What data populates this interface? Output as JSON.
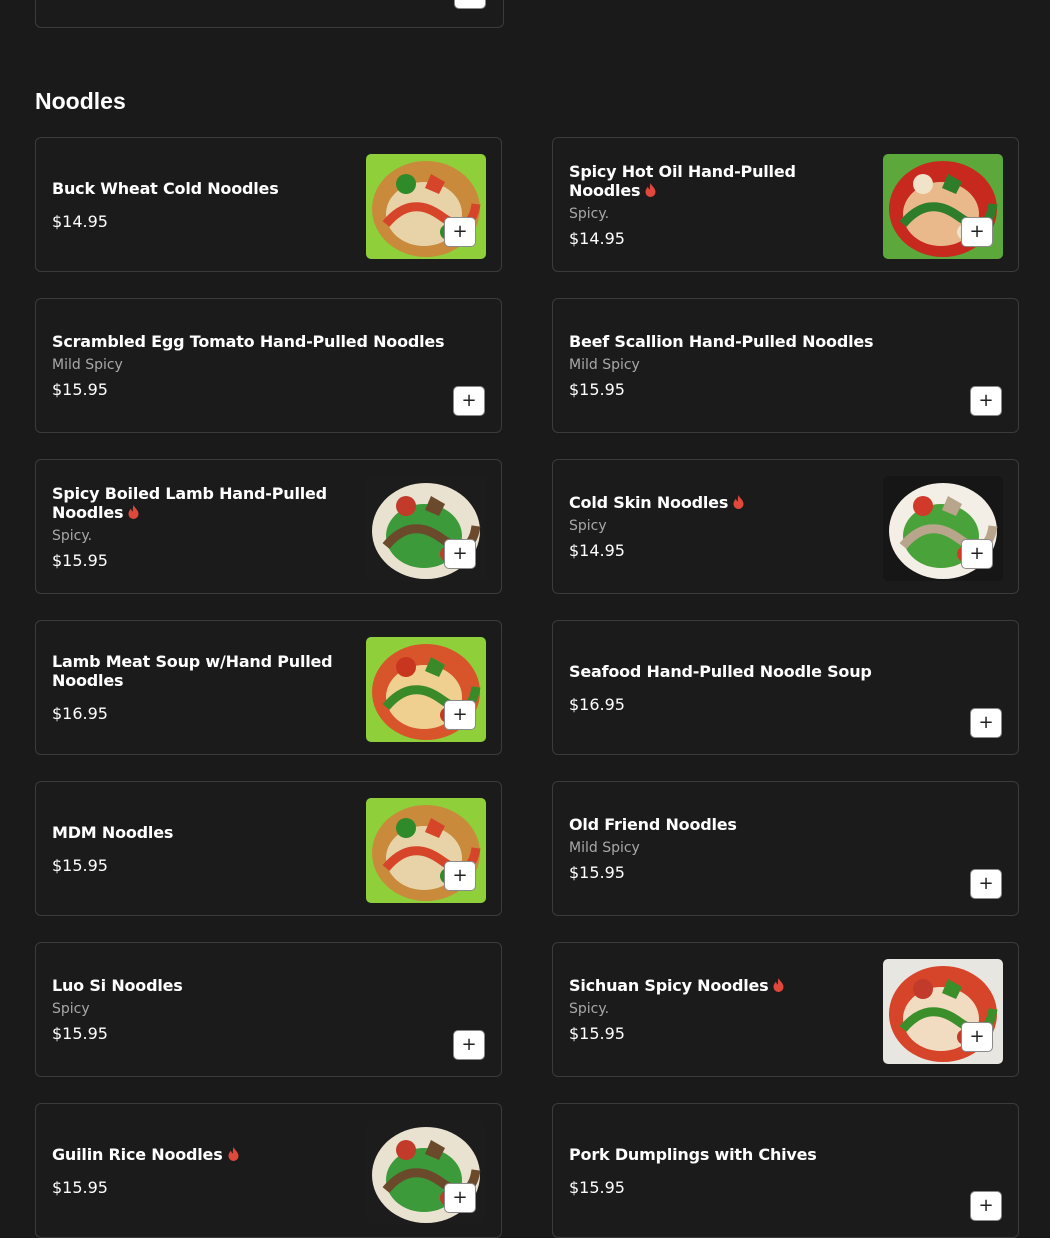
{
  "colors": {
    "background": "#1a1a1b",
    "card_border": "#3b3b3d",
    "description_text": "#a8a8a8",
    "spicy_icon": "#e0483c"
  },
  "icons": {
    "spicy": "flame-icon",
    "add": "plus-icon"
  },
  "add_button_label": "+",
  "section": {
    "title": "Noodles",
    "items": [
      {
        "name": "Buck Wheat Cold Noodles",
        "description": "",
        "price": "$14.95",
        "spicy": false,
        "has_photo": true
      },
      {
        "name": "Spicy Hot Oil Hand-Pulled Noodles",
        "description": "Spicy.",
        "price": "$14.95",
        "spicy": true,
        "has_photo": true
      },
      {
        "name": "Scrambled Egg Tomato Hand-Pulled Noodles",
        "description": "Mild Spicy",
        "price": "$15.95",
        "spicy": false,
        "has_photo": false
      },
      {
        "name": "Beef Scallion Hand-Pulled Noodles",
        "description": "Mild Spicy",
        "price": "$15.95",
        "spicy": false,
        "has_photo": false
      },
      {
        "name": "Spicy Boiled Lamb Hand-Pulled Noodles",
        "description": "Spicy.",
        "price": "$15.95",
        "spicy": true,
        "has_photo": true
      },
      {
        "name": "Cold Skin Noodles",
        "description": "Spicy",
        "price": "$14.95",
        "spicy": true,
        "has_photo": true
      },
      {
        "name": "Lamb Meat Soup w/Hand Pulled Noodles",
        "description": "",
        "price": "$16.95",
        "spicy": false,
        "has_photo": true
      },
      {
        "name": "Seafood Hand-Pulled Noodle Soup",
        "description": "",
        "price": "$16.95",
        "spicy": false,
        "has_photo": false
      },
      {
        "name": "MDM Noodles",
        "description": "",
        "price": "$15.95",
        "spicy": false,
        "has_photo": true
      },
      {
        "name": "Old Friend Noodles",
        "description": "Mild Spicy",
        "price": "$15.95",
        "spicy": false,
        "has_photo": false
      },
      {
        "name": "Luo Si Noodles",
        "description": "Spicy",
        "price": "$15.95",
        "spicy": false,
        "has_photo": false
      },
      {
        "name": "Sichuan Spicy Noodles",
        "description": "Spicy.",
        "price": "$15.95",
        "spicy": true,
        "has_photo": true
      },
      {
        "name": "Guilin Rice Noodles",
        "description": "",
        "price": "$15.95",
        "spicy": true,
        "has_photo": true
      },
      {
        "name": "Pork Dumplings with Chives",
        "description": "",
        "price": "$15.95",
        "spicy": false,
        "has_photo": false
      }
    ]
  }
}
